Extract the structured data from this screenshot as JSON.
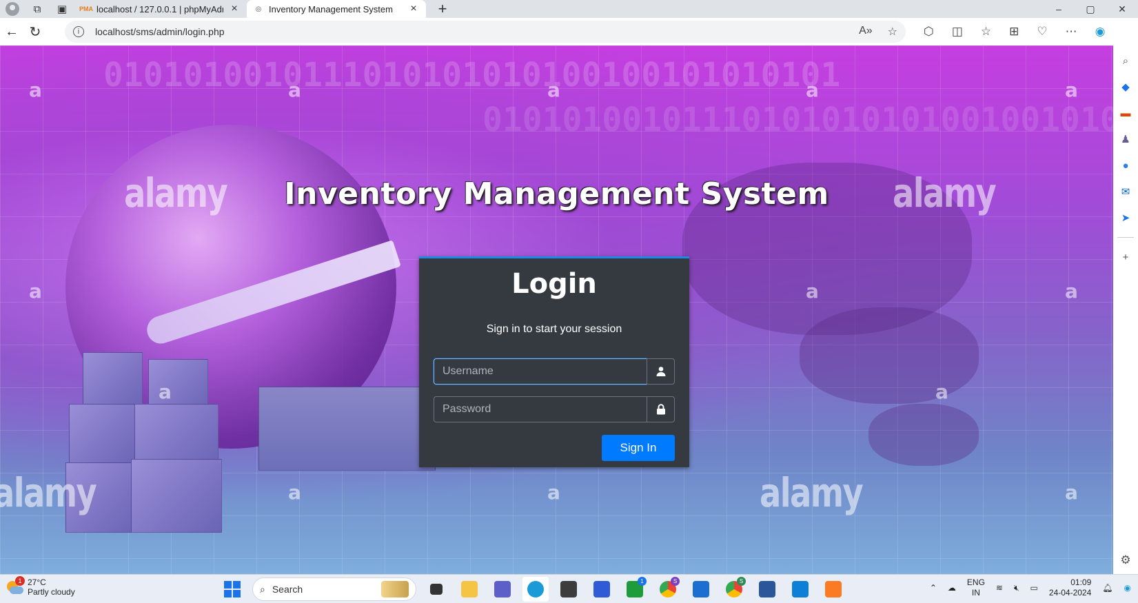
{
  "browser": {
    "tabs": [
      {
        "favicon": "PMA",
        "title": "localhost / 127.0.0.1 | phpMyAdmin",
        "active": false
      },
      {
        "favicon": "page-icon",
        "title": "Inventory Management System",
        "active": true
      }
    ],
    "new_tab_label": "+",
    "url": "localhost/sms/admin/login.php",
    "window_controls": {
      "minimize": "–",
      "maximize": "▢",
      "close": "✕"
    }
  },
  "page": {
    "title": "Inventory Management System",
    "watermark_brand": "alamy",
    "watermark_letter": "a",
    "binary_text": "0101010010111010101010100100101010101",
    "login": {
      "heading": "Login",
      "message": "Sign in to start your session",
      "username_placeholder": "Username",
      "password_placeholder": "Password",
      "signin_label": "Sign In"
    },
    "colors": {
      "card_bg": "#343a40",
      "accent": "#007bff"
    }
  },
  "taskbar": {
    "weather": {
      "temp": "27°C",
      "condition": "Partly cloudy",
      "badge": "1"
    },
    "search_label": "Search",
    "badges": {
      "xbox": "1",
      "chrome": "S",
      "chrome2": "S"
    },
    "lang_top": "ENG",
    "lang_bottom": "IN",
    "time": "01:09",
    "date": "24-04-2024"
  }
}
